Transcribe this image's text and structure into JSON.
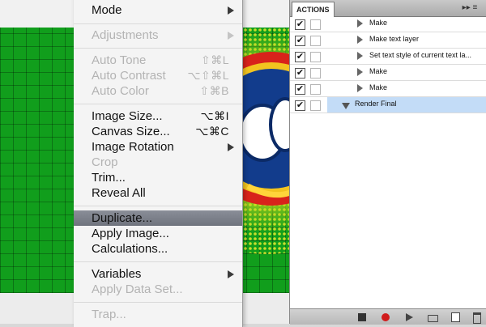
{
  "image_menu": {
    "items": [
      {
        "label": "Mode",
        "shortcut": "",
        "submenu": true,
        "enabled": true
      },
      {
        "label": "Adjustments",
        "shortcut": "",
        "submenu": true,
        "enabled": false
      },
      {
        "label": "Auto Tone",
        "shortcut": "⇧⌘L",
        "submenu": false,
        "enabled": false
      },
      {
        "label": "Auto Contrast",
        "shortcut": "⌥⇧⌘L",
        "submenu": false,
        "enabled": false
      },
      {
        "label": "Auto Color",
        "shortcut": "⇧⌘B",
        "submenu": false,
        "enabled": false
      },
      {
        "label": "Image Size...",
        "shortcut": "⌥⌘I",
        "submenu": false,
        "enabled": true
      },
      {
        "label": "Canvas Size...",
        "shortcut": "⌥⌘C",
        "submenu": false,
        "enabled": true
      },
      {
        "label": "Image Rotation",
        "shortcut": "",
        "submenu": true,
        "enabled": true
      },
      {
        "label": "Crop",
        "shortcut": "",
        "submenu": false,
        "enabled": false
      },
      {
        "label": "Trim...",
        "shortcut": "",
        "submenu": false,
        "enabled": true
      },
      {
        "label": "Reveal All",
        "shortcut": "",
        "submenu": false,
        "enabled": true
      },
      {
        "label": "Duplicate...",
        "shortcut": "",
        "submenu": false,
        "enabled": true,
        "highlighted": true
      },
      {
        "label": "Apply Image...",
        "shortcut": "",
        "submenu": false,
        "enabled": true
      },
      {
        "label": "Calculations...",
        "shortcut": "",
        "submenu": false,
        "enabled": true
      },
      {
        "label": "Variables",
        "shortcut": "",
        "submenu": true,
        "enabled": true
      },
      {
        "label": "Apply Data Set...",
        "shortcut": "",
        "submenu": false,
        "enabled": false
      },
      {
        "label": "Trap...",
        "shortcut": "",
        "submenu": false,
        "enabled": false
      }
    ]
  },
  "actions_panel": {
    "tab_label": "ACTIONS",
    "menu_glyph": "▸▸ ≡",
    "rows": [
      {
        "label": "Make",
        "checked": true,
        "type": "step"
      },
      {
        "label": "Make text layer",
        "checked": true,
        "type": "step"
      },
      {
        "label": "Set text style of current text la...",
        "checked": true,
        "type": "step"
      },
      {
        "label": "Make",
        "checked": true,
        "type": "step"
      },
      {
        "label": "Make",
        "checked": true,
        "type": "step"
      },
      {
        "label": "Render Final",
        "checked": true,
        "type": "set",
        "selected": true
      }
    ],
    "footer_buttons": [
      "stop",
      "record",
      "play",
      "new-set",
      "new-action",
      "delete"
    ]
  },
  "colors": {
    "record": "#d01b1b",
    "selection": "#c3dcf7",
    "menu_highlight": "#7c808a",
    "artwork_green": "#119e1c"
  },
  "icons": {
    "check": "✔",
    "submenu": "submenu-arrow-icon"
  }
}
